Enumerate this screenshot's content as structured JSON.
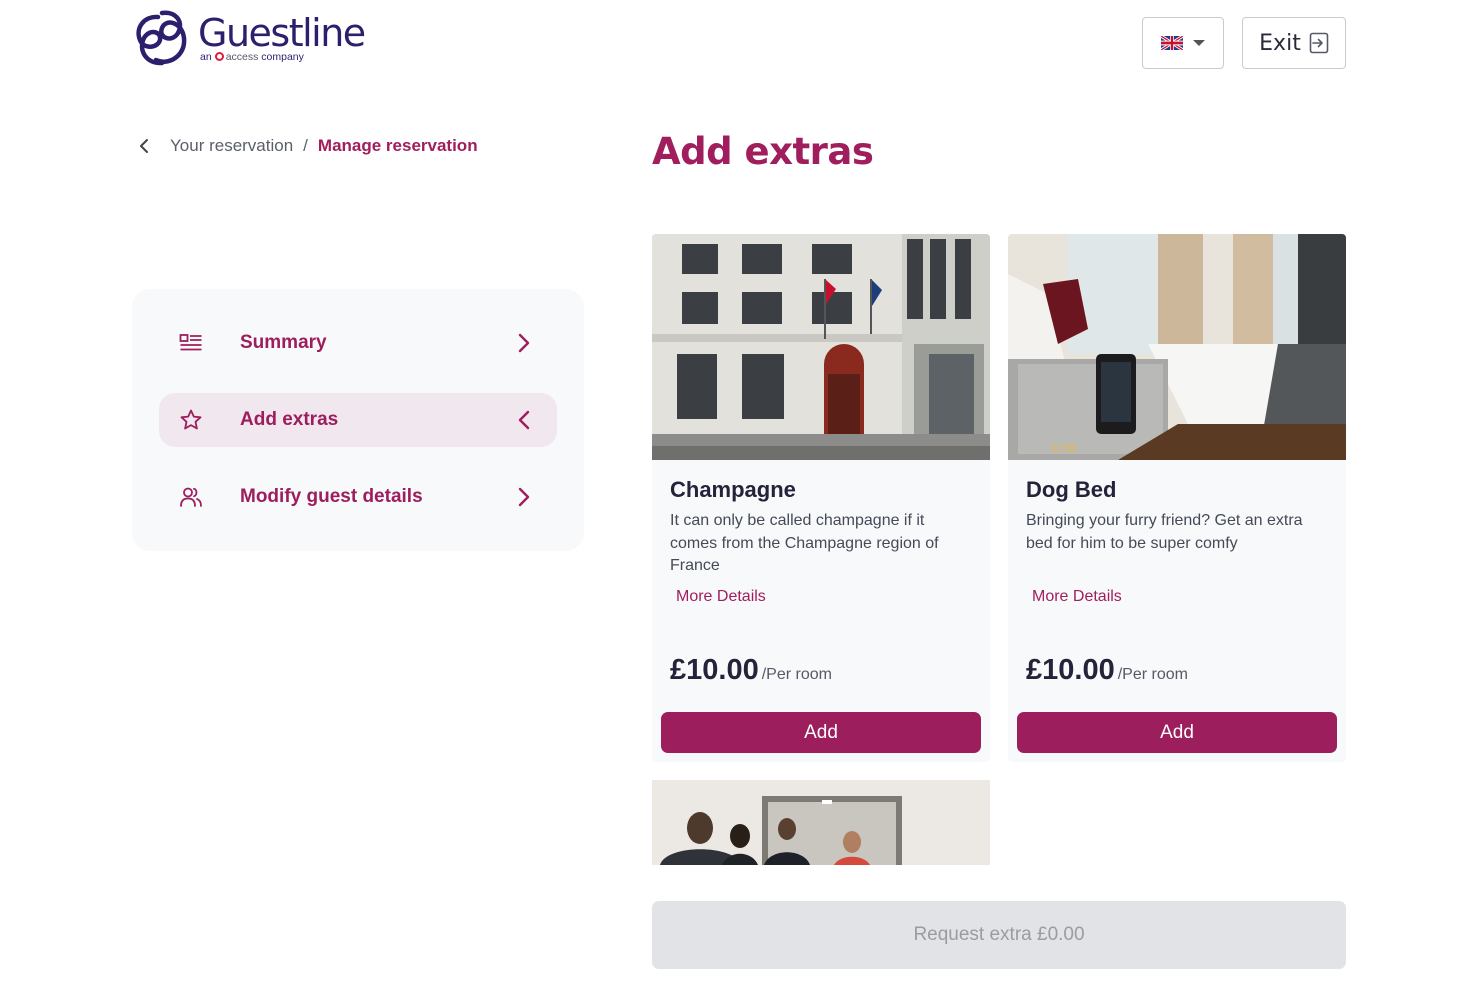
{
  "header": {
    "logo_name": "Guestline",
    "logo_sub_an": "an",
    "logo_sub_access": "access",
    "logo_sub_company": "company",
    "language_flag": "uk-flag-icon",
    "exit_label": "Exit"
  },
  "breadcrumb": {
    "back_icon": "chevron-left-icon",
    "parent": "Your reservation",
    "separator": "/",
    "current": "Manage reservation"
  },
  "menu": {
    "items": [
      {
        "label": "Summary",
        "icon": "summary-list-icon",
        "active": false
      },
      {
        "label": "Add extras",
        "icon": "star-icon",
        "active": true
      },
      {
        "label": "Modify guest details",
        "icon": "guests-icon",
        "active": false
      }
    ]
  },
  "main": {
    "title": "Add extras",
    "extras": [
      {
        "name": "Champagne",
        "description": "It can only be called champagne if it comes from the Champagne region of France",
        "more": "More Details",
        "price": "£10.00",
        "unit": "/Per room",
        "add_label": "Add",
        "image": "hotel-facade-photo"
      },
      {
        "name": "Dog Bed",
        "description": "Bringing your furry friend? Get an extra bed for him to be super comfy",
        "more": "More Details",
        "price": "£10.00",
        "unit": "/Per room",
        "add_label": "Add",
        "image": "hotel-room-photo"
      },
      {
        "image": "reception-people-photo"
      }
    ],
    "request_label": "Request extra £0.00"
  },
  "colors": {
    "brand": "#9c1e5c",
    "logo": "#2d1f6e",
    "disabled_bg": "#e2e3e6"
  }
}
